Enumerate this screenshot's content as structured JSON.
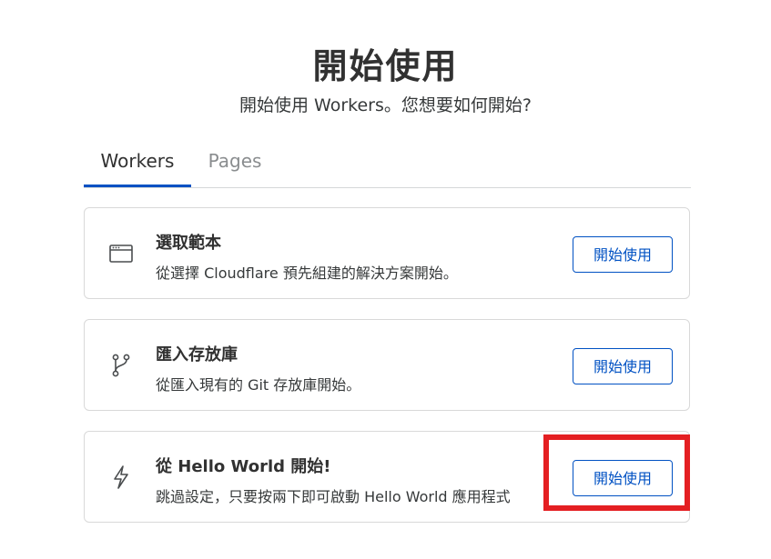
{
  "header": {
    "title": "開始使用",
    "subtitle": "開始使用 Workers。您想要如何開始?"
  },
  "tabs": [
    {
      "label": "Workers",
      "active": true
    },
    {
      "label": "Pages",
      "active": false
    }
  ],
  "cards": [
    {
      "icon": "browser-window-icon",
      "title": "選取範本",
      "description": "從選擇 Cloudflare 預先組建的解決方案開始。",
      "button_label": "開始使用"
    },
    {
      "icon": "git-branch-icon",
      "title": "匯入存放庫",
      "description": "從匯入現有的 Git 存放庫開始。",
      "button_label": "開始使用"
    },
    {
      "icon": "lightning-bolt-icon",
      "title": "從 Hello World 開始!",
      "description": "跳過設定，只要按兩下即可啟動 Hello World 應用程式",
      "button_label": "開始使用"
    }
  ],
  "colors": {
    "accent": "#0051c3",
    "highlight": "#e41f22",
    "border": "#d9d9d9"
  }
}
